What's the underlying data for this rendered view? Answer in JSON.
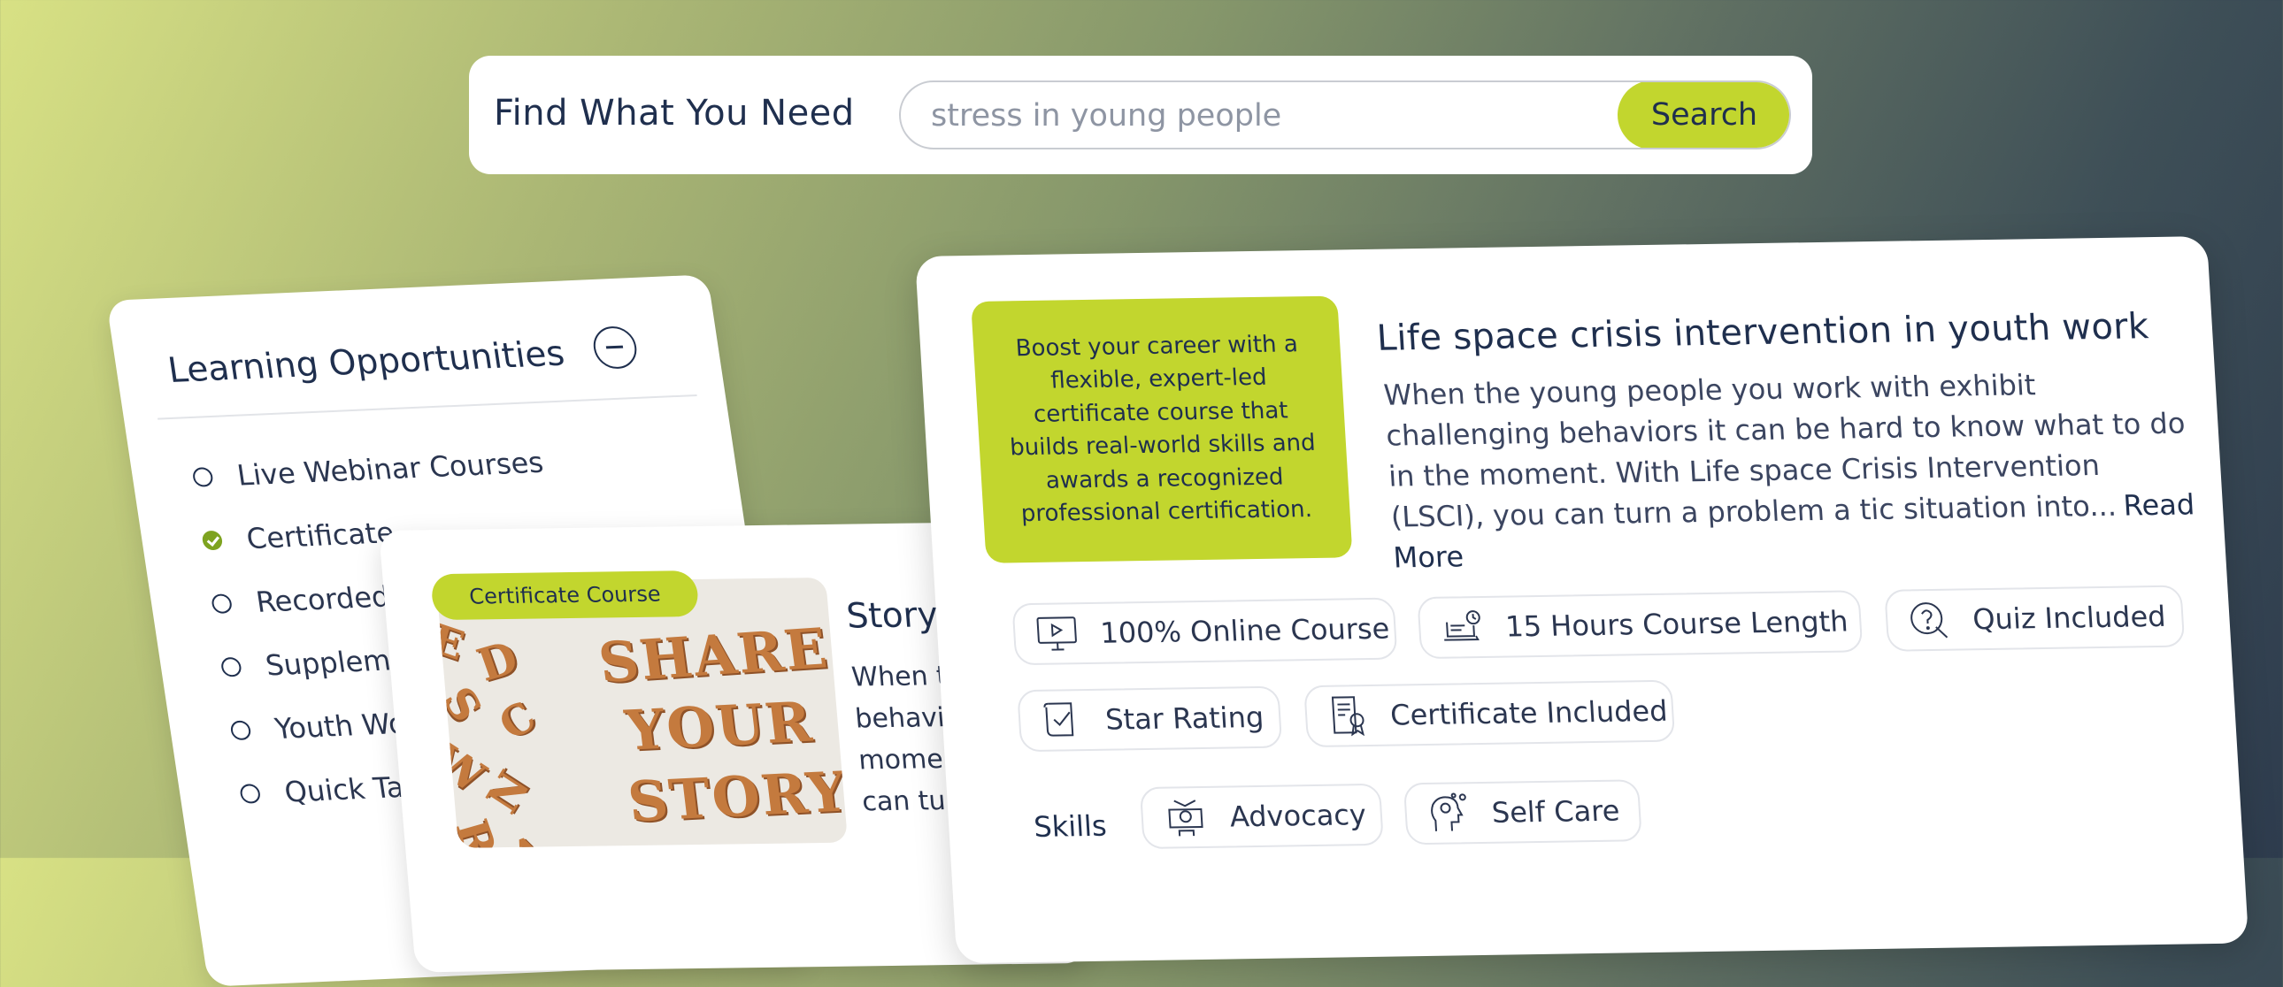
{
  "search": {
    "title": "Find What You Need",
    "value": "stress in young people",
    "button_label": "Search"
  },
  "filter": {
    "title": "Learning Opportunities",
    "items": [
      {
        "label": "Live Webinar Courses",
        "checked": false
      },
      {
        "label": "Certificate",
        "checked": true
      },
      {
        "label": "Recorded",
        "checked": false
      },
      {
        "label": "Supplemen",
        "checked": false
      },
      {
        "label": "Youth Wor",
        "checked": false
      },
      {
        "label": "Quick Tak",
        "checked": false
      }
    ]
  },
  "card2": {
    "badge": "Certificate Course",
    "title": "Storyt",
    "desc_lines": [
      "When th",
      "behavic",
      "momen",
      "can tur"
    ],
    "image_words": [
      "SHARE",
      "YOUR",
      "STORY"
    ]
  },
  "main_card": {
    "promo": "Boost your career with a flexible, expert-led certificate course that builds real-world skills and awards a recognized professional certification.",
    "title": "Life space crisis intervention in youth work",
    "description": "When the young people you work with exhibit challenging behaviors it can be hard to know what to do in the moment. With Life space Crisis Intervention (LSCI), you can turn a problem a tic situation into...",
    "read_more": "Read More",
    "features": [
      {
        "label": "100% Online Course",
        "icon": "monitor-play-icon"
      },
      {
        "label": "15 Hours Course Length",
        "icon": "laptop-clock-icon"
      },
      {
        "label": "Quiz Included",
        "icon": "quiz-question-icon"
      },
      {
        "label": "Star Rating",
        "icon": "scroll-check-icon"
      },
      {
        "label": "Certificate Included",
        "icon": "certificate-icon"
      }
    ],
    "skills_label": "Skills",
    "skills": [
      {
        "label": "Advocacy",
        "icon": "advocacy-icon"
      },
      {
        "label": "Self Care",
        "icon": "self-care-icon"
      }
    ]
  },
  "colors": {
    "accent": "#c2d62e",
    "text_dark": "#1f2f4e",
    "check": "#7ea320"
  }
}
